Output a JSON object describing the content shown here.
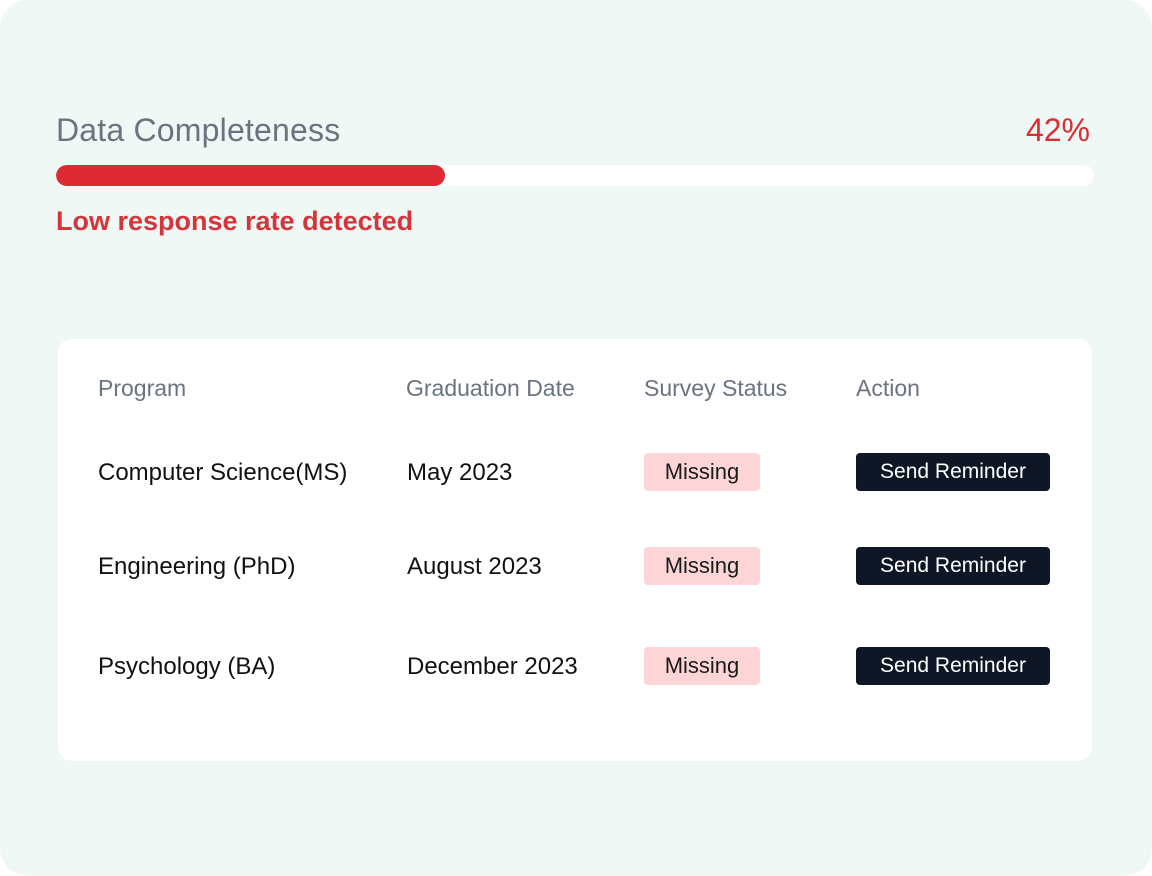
{
  "colors": {
    "accent_red": "#de2a33",
    "warning_red": "#d5353a",
    "badge_bg": "#fdd5d7",
    "button_bg": "#0f1726",
    "background": "#eff8f4"
  },
  "completeness": {
    "title": "Data Completeness",
    "percent_label": "42%",
    "percent_value": 0.375,
    "warning": "Low response rate detected"
  },
  "table": {
    "headers": {
      "program": "Program",
      "graduation_date": "Graduation Date",
      "survey_status": "Survey Status",
      "action": "Action"
    },
    "rows": [
      {
        "program": "Computer Science(MS)",
        "graduation_date": "May 2023",
        "survey_status": "Missing",
        "action_label": "Send Reminder"
      },
      {
        "program": "Engineering (PhD)",
        "graduation_date": "August 2023",
        "survey_status": "Missing",
        "action_label": "Send Reminder"
      },
      {
        "program": "Psychology (BA)",
        "graduation_date": "December 2023",
        "survey_status": "Missing",
        "action_label": "Send Reminder"
      }
    ]
  }
}
